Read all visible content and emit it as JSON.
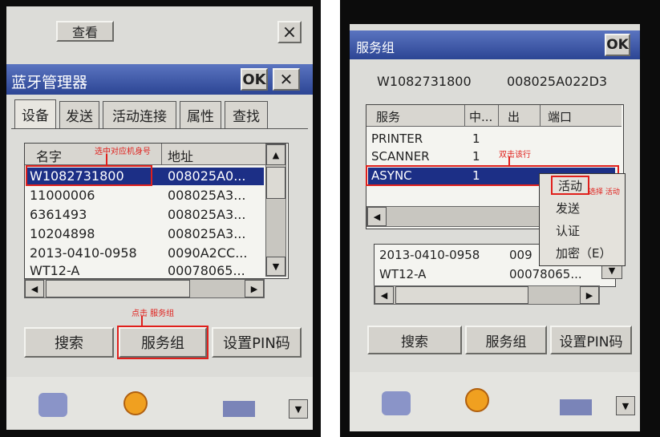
{
  "left": {
    "top_button": "查看",
    "close_x": "×",
    "window_title": "蓝牙管理器",
    "ok": "OK",
    "tabs": [
      "设备",
      "发送",
      "活动连接",
      "属性",
      "查找"
    ],
    "columns": [
      "名字",
      "地址"
    ],
    "rows": [
      {
        "name": "W1082731800",
        "addr": "008025A0..."
      },
      {
        "name": "11000006",
        "addr": "008025A3..."
      },
      {
        "name": "6361493",
        "addr": "008025A3..."
      },
      {
        "name": "10204898",
        "addr": "008025A3..."
      },
      {
        "name": "2013-0410-0958",
        "addr": "0090A2CC..."
      },
      {
        "name": "WT12-A",
        "addr": "00078065..."
      }
    ],
    "buttons": {
      "search": "搜索",
      "service_group": "服务组",
      "pin": "设置PIN码"
    },
    "annotations": {
      "select_device": "选中对应机身号",
      "click_service": "点击 服务组"
    }
  },
  "right": {
    "window_title": "服务组",
    "ok": "OK",
    "device_name": "W1082731800",
    "device_addr": "008025A022D3",
    "columns": [
      "服务",
      "中...",
      "出",
      "端口"
    ],
    "rows": [
      {
        "service": "PRINTER",
        "in": "1"
      },
      {
        "service": "SCANNER",
        "in": "1"
      },
      {
        "service": "ASYNC",
        "in": "1"
      }
    ],
    "context_menu": [
      "活动",
      "发送",
      "认证",
      "加密（E）"
    ],
    "bg_rows": [
      {
        "name": "2013-0410-0958",
        "addr": "009"
      },
      {
        "name": "WT12-A",
        "addr": "00078065..."
      }
    ],
    "buttons": {
      "search": "搜索",
      "service_group": "服务组",
      "pin": "设置PIN码"
    },
    "annotations": {
      "double_click": "双击该行",
      "select_active": "选择 活动"
    }
  },
  "colors": {
    "title_blue": "#2c4594",
    "selection": "#1c2f86",
    "annotation_red": "#e0201c"
  }
}
